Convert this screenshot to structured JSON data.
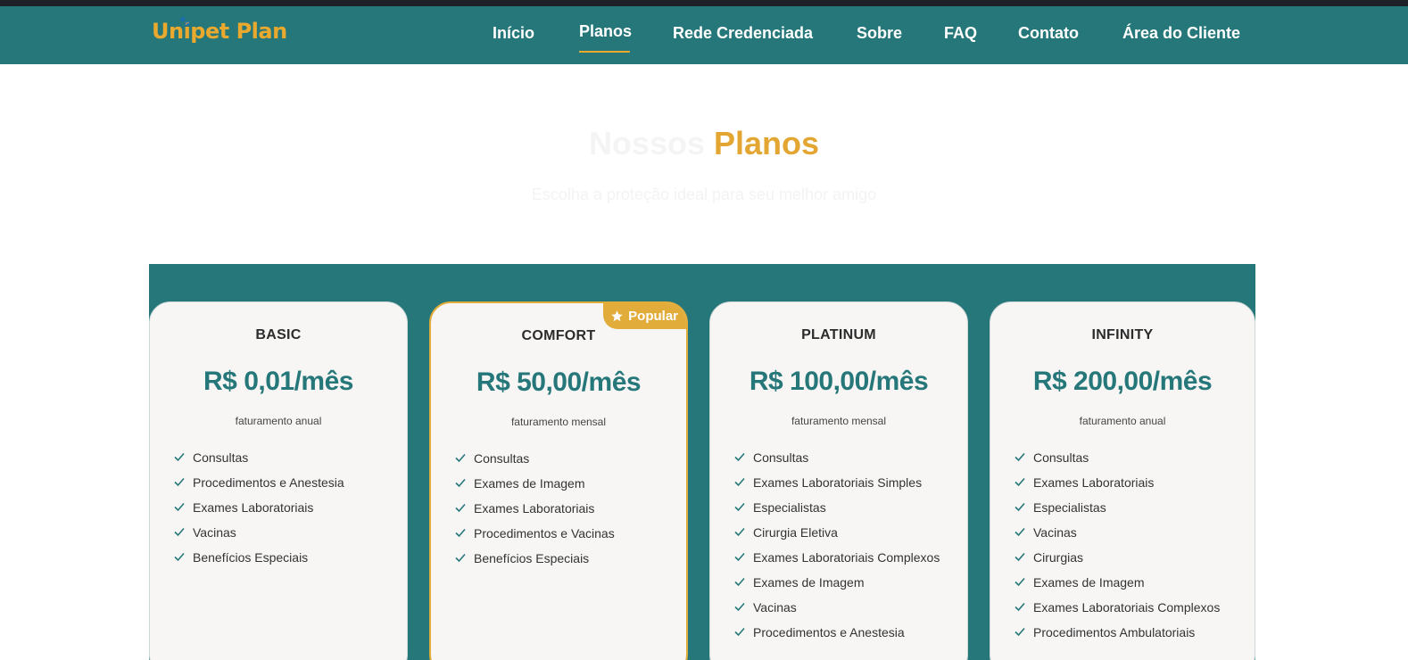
{
  "nav": {
    "logo": "Unipet Plan",
    "links": [
      "Início",
      "Planos",
      "Rede Credenciada",
      "Sobre",
      "FAQ",
      "Contato",
      "Área do Cliente"
    ],
    "active": "Planos"
  },
  "hero": {
    "title_part1": "Nossos",
    "title_part2": "Planos",
    "subtitle": "Escolha a proteção ideal para seu melhor amigo"
  },
  "colors": {
    "primary": "#267779",
    "accent": "#e1ac3a",
    "topbar": "#1f2128"
  },
  "plans": [
    {
      "name": "BASIC",
      "price": "R$ 0,01/mês",
      "billing": "faturamento anual",
      "features": [
        "Consultas",
        "Procedimentos e Anestesia",
        "Exames Laboratoriais",
        "Vacinas",
        "Benefícios Especiais"
      ]
    },
    {
      "name": "COMFORT",
      "price": "R$ 50,00/mês",
      "billing": "faturamento mensal",
      "badge": "Popular",
      "badge_icon": "star-icon",
      "features": [
        "Consultas",
        "Exames de Imagem",
        "Exames Laboratoriais",
        "Procedimentos e Vacinas",
        "Benefícios Especiais"
      ]
    },
    {
      "name": "PLATINUM",
      "price": "R$ 100,00/mês",
      "billing": "faturamento mensal",
      "features": [
        "Consultas",
        "Exames Laboratoriais Simples",
        "Especialistas",
        "Cirurgia Eletiva",
        "Exames Laboratoriais Complexos",
        "Exames de Imagem",
        "Vacinas",
        "Procedimentos e Anestesia"
      ]
    },
    {
      "name": "INFINITY",
      "price": "R$ 200,00/mês",
      "billing": "faturamento anual",
      "features": [
        "Consultas",
        "Exames Laboratoriais",
        "Especialistas",
        "Vacinas",
        "Cirurgias",
        "Exames de Imagem",
        "Exames Laboratoriais Complexos",
        "Procedimentos Ambulatoriais"
      ]
    }
  ],
  "icons": {
    "feature": "check-icon"
  }
}
